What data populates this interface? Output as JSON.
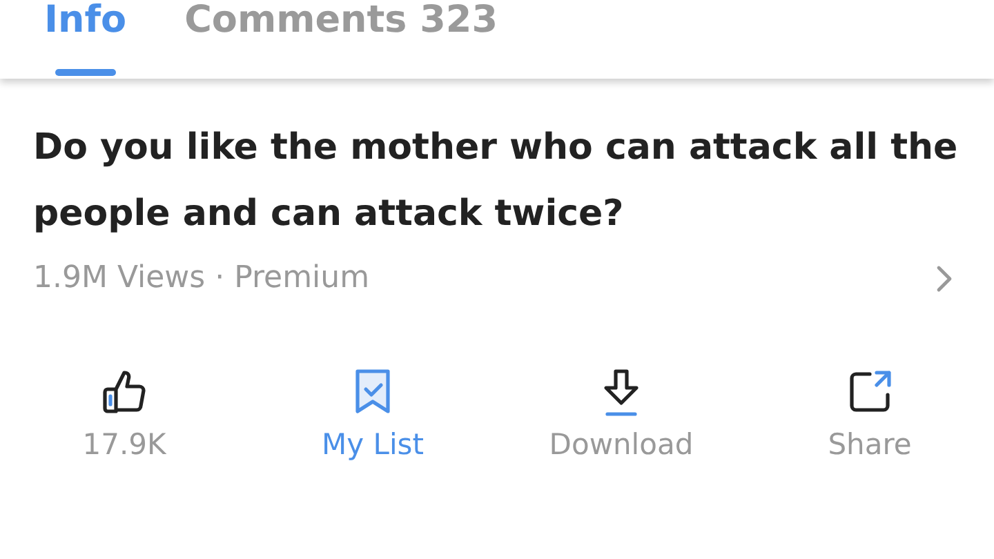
{
  "tabs": [
    {
      "label": "Info",
      "selected": true
    },
    {
      "label": "Comments 323",
      "selected": false
    }
  ],
  "video": {
    "title": "Do you like the mother who can attack all the people and can attack twice?",
    "meta": "1.9M Views · Premium"
  },
  "actions": [
    {
      "kind": "like",
      "label": "17.9K",
      "selected": false
    },
    {
      "kind": "mylist",
      "label": "My List",
      "selected": true
    },
    {
      "kind": "download",
      "label": "Download",
      "selected": false
    },
    {
      "kind": "share",
      "label": "Share",
      "selected": false
    }
  ]
}
